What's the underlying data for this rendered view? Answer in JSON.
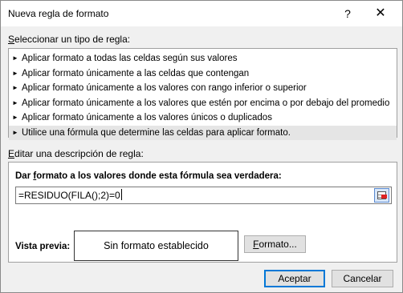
{
  "dialog": {
    "title": "Nueva regla de formato",
    "help_glyph": "?",
    "close_glyph": "✕"
  },
  "rule_type": {
    "label_prefix": "",
    "label_ul": "S",
    "label_rest": "eleccionar un tipo de regla:",
    "items": [
      {
        "label": "Aplicar formato a todas las celdas según sus valores"
      },
      {
        "label": "Aplicar formato únicamente a las celdas que contengan"
      },
      {
        "label": "Aplicar formato únicamente a los valores con rango inferior o superior"
      },
      {
        "label": "Aplicar formato únicamente a los valores que estén por encima o por debajo del promedio"
      },
      {
        "label": "Aplicar formato únicamente a los valores únicos o duplicados"
      },
      {
        "label": "Utilice una fórmula que determine las celdas para aplicar formato."
      }
    ],
    "selected_index": 5
  },
  "rule_description": {
    "label_ul": "E",
    "label_rest": "ditar una descripción de regla:",
    "heading_pre": "Dar ",
    "heading_ul": "f",
    "heading_post": "ormato a los valores donde esta fórmula sea verdadera:",
    "formula_value": "=RESIDUO(FILA();2)=0",
    "preview_label": "Vista previa:",
    "preview_text": "Sin formato establecido",
    "format_button_ul": "F",
    "format_button_rest": "ormato..."
  },
  "buttons": {
    "ok_label": "Aceptar",
    "cancel_label": "Cancelar"
  },
  "colors": {
    "selection_bg": "#e5e5e5",
    "default_button_border": "#0078d7"
  }
}
